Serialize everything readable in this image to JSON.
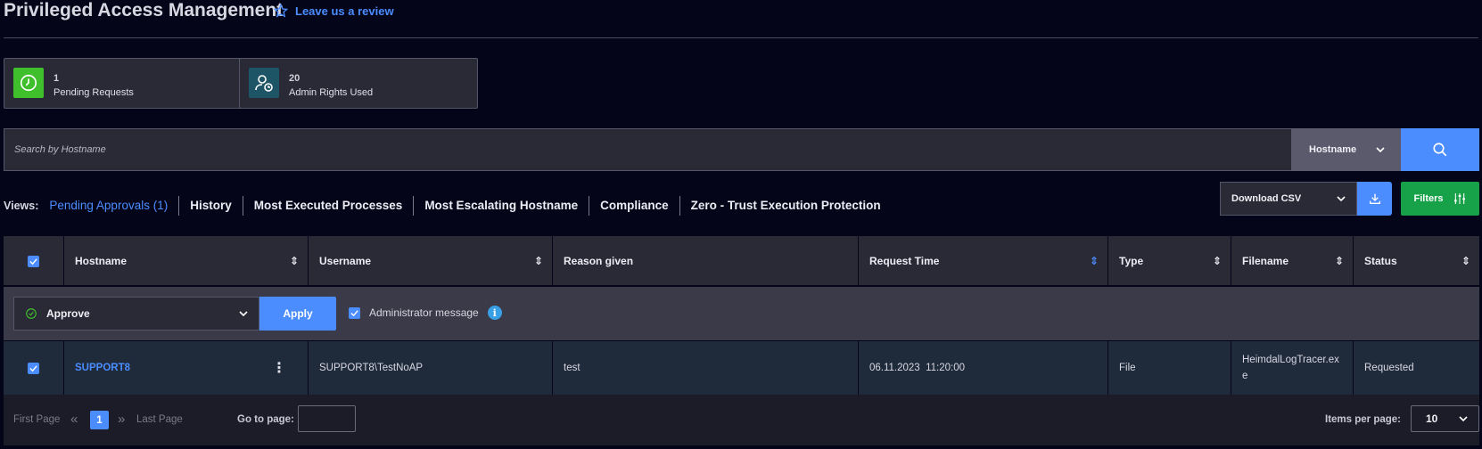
{
  "header": {
    "title": "Privileged Access Management",
    "review_link": "Leave us a review"
  },
  "cards": [
    {
      "count": "1",
      "label": "Pending Requests",
      "icon": "clock-icon",
      "color": "#3fbf2c"
    },
    {
      "count": "20",
      "label": "Admin Rights Used",
      "icon": "user-clock-icon",
      "color": "#1e5566"
    }
  ],
  "search": {
    "placeholder": "Search by Hostname",
    "field_select": "Hostname"
  },
  "views": {
    "label": "Views:",
    "items": [
      "Pending Approvals (1)",
      "History",
      "Most Executed Processes",
      "Most Escalating Hostname",
      "Compliance",
      "Zero - Trust Execution Protection"
    ]
  },
  "toolbar": {
    "download_label": "Download CSV",
    "filters_label": "Filters"
  },
  "table": {
    "columns": [
      "Hostname",
      "Username",
      "Reason given",
      "Request Time",
      "Type",
      "Filename",
      "Status"
    ],
    "action": {
      "select_value": "Approve",
      "apply_label": "Apply",
      "admin_message_label": "Administrator message"
    },
    "rows": [
      {
        "hostname": "SUPPORT8",
        "username": "SUPPORT8\\TestNoAP",
        "reason": "test",
        "request_time": "06.11.2023  11:20:00",
        "type": "File",
        "filename": "HeimdalLogTracer.exe",
        "status": "Requested"
      }
    ]
  },
  "pagination": {
    "first": "First Page",
    "current": "1",
    "last": "Last Page",
    "goto_label": "Go to page:",
    "items_per_page_label": "Items per page:",
    "items_per_page": "10"
  },
  "colors": {
    "accent": "#4b8dff",
    "success": "#17a148",
    "background": "#05051a"
  }
}
